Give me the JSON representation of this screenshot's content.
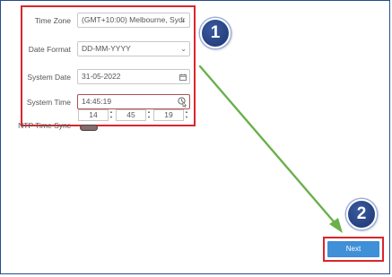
{
  "form": {
    "time_zone": {
      "label": "Time Zone",
      "value": "(GMT+10:00) Melbourne, Sydr"
    },
    "date_format": {
      "label": "Date Format",
      "value": "DD-MM-YYYY"
    },
    "system_date": {
      "label": "System Date",
      "value": "31-05-2022"
    },
    "system_time": {
      "label": "System Time",
      "value": "14:45:19",
      "hours": "14",
      "minutes": "45",
      "seconds": "19"
    },
    "ntp_sync": {
      "label": "NTP Time Sync"
    }
  },
  "steps": {
    "step1": "1",
    "step2": "2"
  },
  "footer": {
    "next_label": "Next"
  },
  "colors": {
    "highlight": "#d9262b",
    "accent_button": "#3f8fd9",
    "badge": "#1d3570",
    "arrow": "#6ab04c"
  },
  "icons": [
    "chevron-down-icon",
    "calendar-icon",
    "clock-icon",
    "cursor-icon",
    "arrow-icon"
  ]
}
